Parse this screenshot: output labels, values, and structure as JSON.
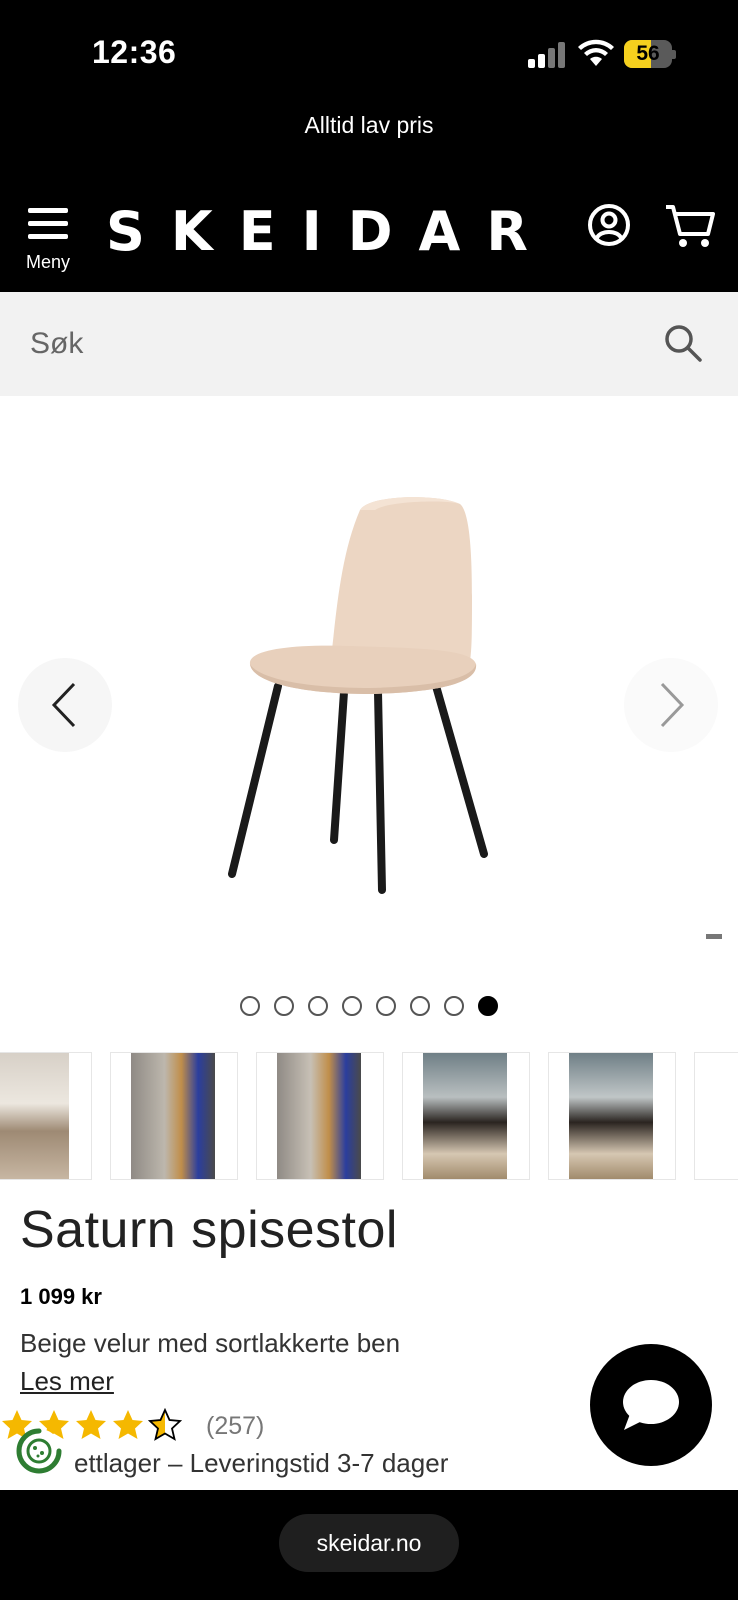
{
  "status_bar": {
    "time": "12:36",
    "battery": "56",
    "battery_level": 0.56
  },
  "promo": {
    "text": "Alltid lav pris"
  },
  "header": {
    "menu_label": "Meny",
    "logo": "SKEIDAR",
    "account_icon": "account-icon",
    "cart_icon": "cart-icon"
  },
  "search": {
    "placeholder": "Søk",
    "icon": "search-icon"
  },
  "gallery": {
    "image_count": 8,
    "active_index": 7,
    "prev_icon": "chevron-left-icon",
    "next_icon": "chevron-right-icon"
  },
  "product": {
    "title": "Saturn spisestol",
    "price": "1 099 kr",
    "description": "Beige velur med sortlakkerte ben",
    "read_more": "Les mer",
    "rating": 4.5,
    "review_count": "(257)",
    "stock": "ettlager – Leveringstid 3-7 dager"
  },
  "browser": {
    "url": "skeidar.no"
  },
  "colors": {
    "brand_black": "#000000",
    "star": "#f5b800",
    "battery": "#f5d01e"
  }
}
